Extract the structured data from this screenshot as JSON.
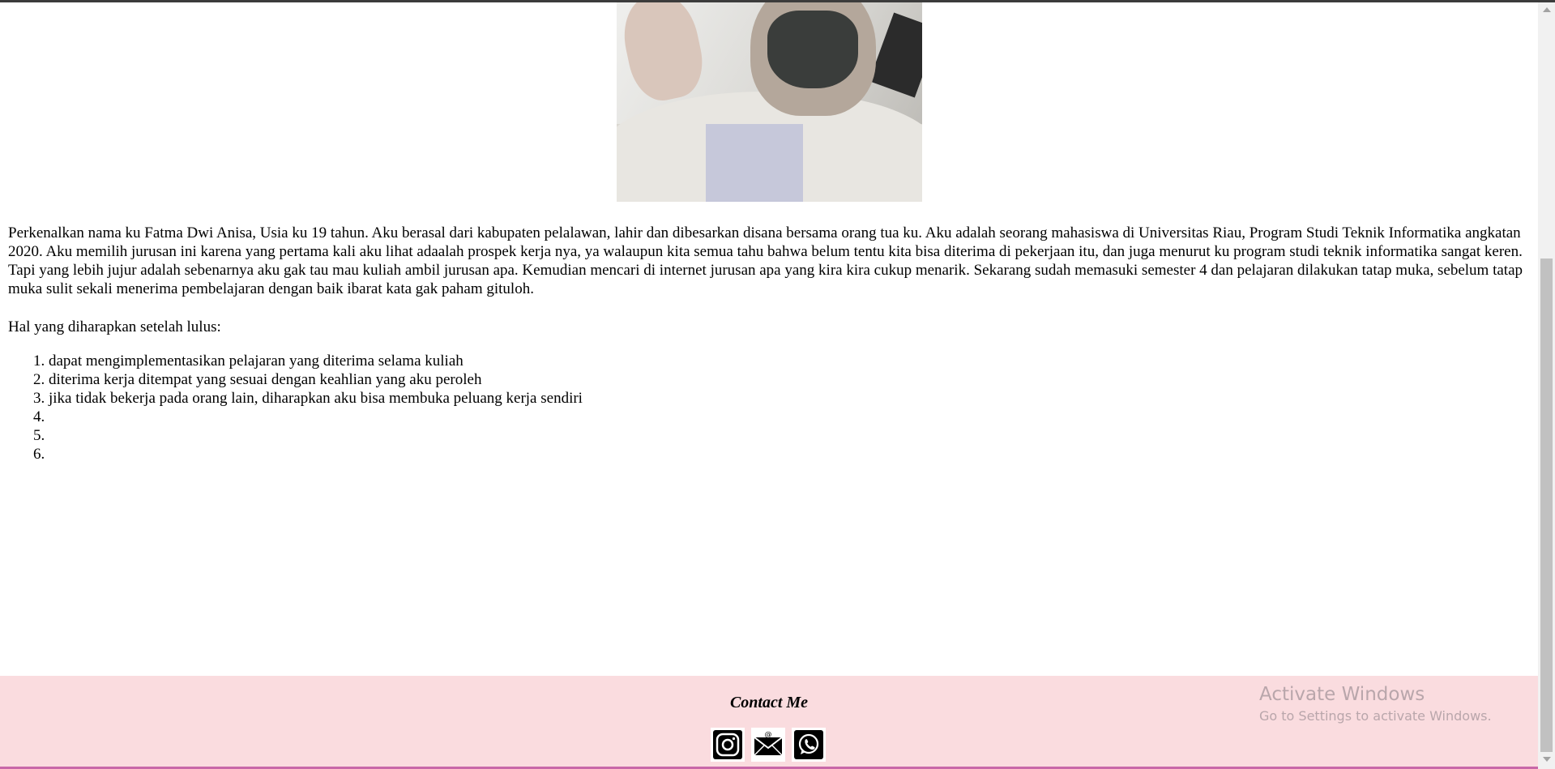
{
  "profile": {
    "intro": "Perkenalkan nama ku Fatma Dwi Anisa, Usia ku 19 tahun. Aku berasal dari kabupaten pelalawan, lahir dan dibesarkan disana bersama orang tua ku. Aku adalah seorang mahasiswa di Universitas Riau, Program Studi Teknik Informatika angkatan 2020. Aku memilih jurusan ini karena yang pertama kali aku lihat adaalah prospek kerja nya, ya walaupun kita semua tahu bahwa belum tentu kita bisa diterima di pekerjaan itu, dan juga menurut ku program studi teknik informatika sangat keren. Tapi yang lebih jujur adalah sebenarnya aku gak tau mau kuliah ambil jurusan apa. Kemudian mencari di internet jurusan apa yang kira kira cukup menarik. Sekarang sudah memasuki semester 4 dan pelajaran dilakukan tatap muka, sebelum tatap muka sulit sekali menerima pembelajaran dengan baik ibarat kata gak paham gituloh.",
    "hopes_heading": "Hal yang diharapkan setelah lulus:",
    "goals": [
      "dapat mengimplementasikan pelajaran yang diterima selama kuliah",
      "diterima kerja ditempat yang sesuai dengan keahlian yang aku peroleh",
      "jika tidak bekerja pada orang lain, diharapkan aku bisa membuka peluang kerja sendiri",
      "",
      "",
      ""
    ]
  },
  "footer": {
    "title": "Contact Me",
    "icons": [
      "instagram-icon",
      "email-icon",
      "whatsapp-icon"
    ],
    "background": "#fadcdf"
  },
  "watermark": {
    "line1": "Activate Windows",
    "line2": "Go to Settings to activate Windows."
  }
}
